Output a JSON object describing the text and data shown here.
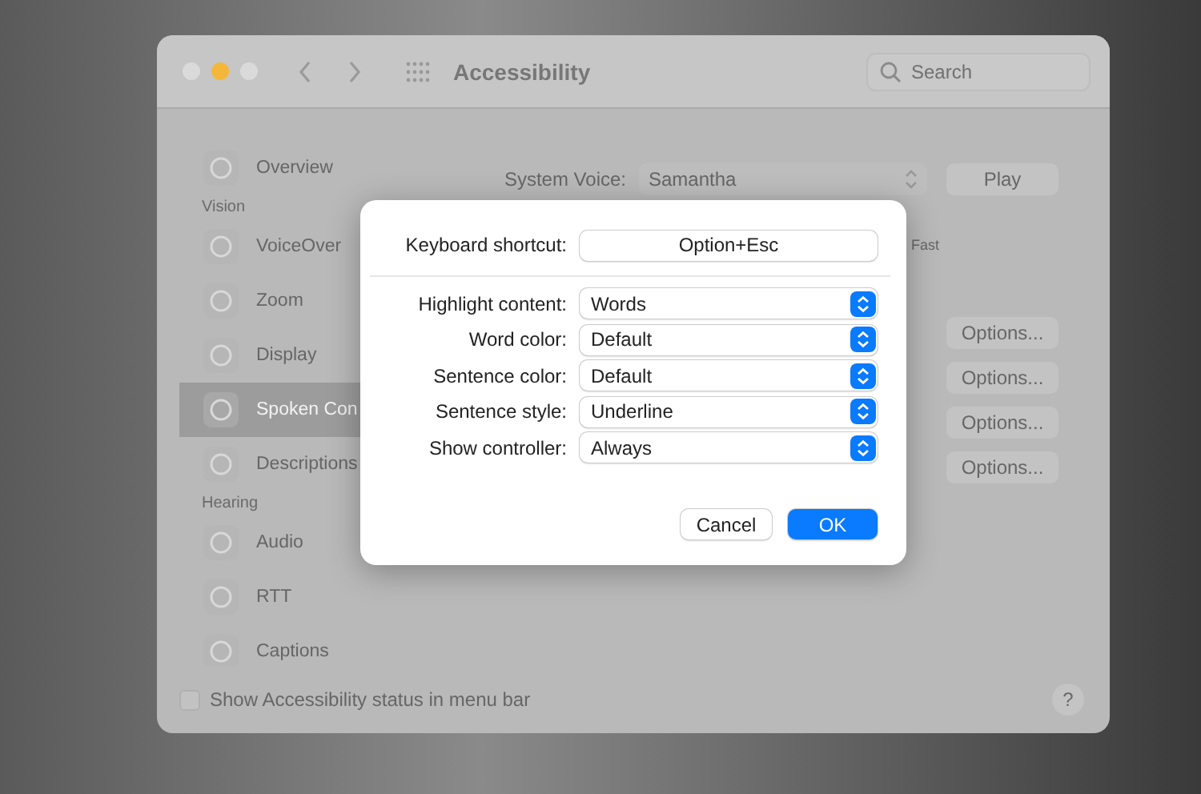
{
  "window": {
    "title": "Accessibility",
    "search": {
      "placeholder": "Search"
    }
  },
  "sidebar": {
    "items": [
      {
        "kind": "item",
        "label": "Overview",
        "selected": false
      },
      {
        "kind": "header",
        "label": "Vision"
      },
      {
        "kind": "item",
        "label": "VoiceOver",
        "selected": false
      },
      {
        "kind": "item",
        "label": "Zoom",
        "selected": false
      },
      {
        "kind": "item",
        "label": "Display",
        "selected": false
      },
      {
        "kind": "item",
        "label": "Spoken Con",
        "selected": true
      },
      {
        "kind": "item",
        "label": "Descriptions",
        "selected": false
      },
      {
        "kind": "header",
        "label": "Hearing"
      },
      {
        "kind": "item",
        "label": "Audio",
        "selected": false
      },
      {
        "kind": "item",
        "label": "RTT",
        "selected": false
      },
      {
        "kind": "item",
        "label": "Captions",
        "selected": false
      }
    ]
  },
  "voice": {
    "label": "System Voice:",
    "value": "Samantha",
    "button": "Play"
  },
  "rate_label": "Fast",
  "options_buttons": [
    "Options...",
    "Options...",
    "Options...",
    "Options..."
  ],
  "footer": {
    "checkbox": {
      "label": "Show Accessibility status in menu bar",
      "checked": false
    },
    "help": "?"
  },
  "dialog": {
    "shortcut": {
      "label": "Keyboard shortcut:",
      "value": "Option+Esc"
    },
    "rows": [
      {
        "label": "Highlight content:",
        "value": "Words"
      },
      {
        "label": "Word color:",
        "value": "Default"
      },
      {
        "label": "Sentence color:",
        "value": "Default"
      },
      {
        "label": "Sentence style:",
        "value": "Underline"
      },
      {
        "label": "Show controller:",
        "value": "Always"
      }
    ],
    "buttons": [
      {
        "kind": "cancel",
        "label": "Cancel"
      },
      {
        "kind": "default",
        "label": "OK"
      }
    ]
  }
}
